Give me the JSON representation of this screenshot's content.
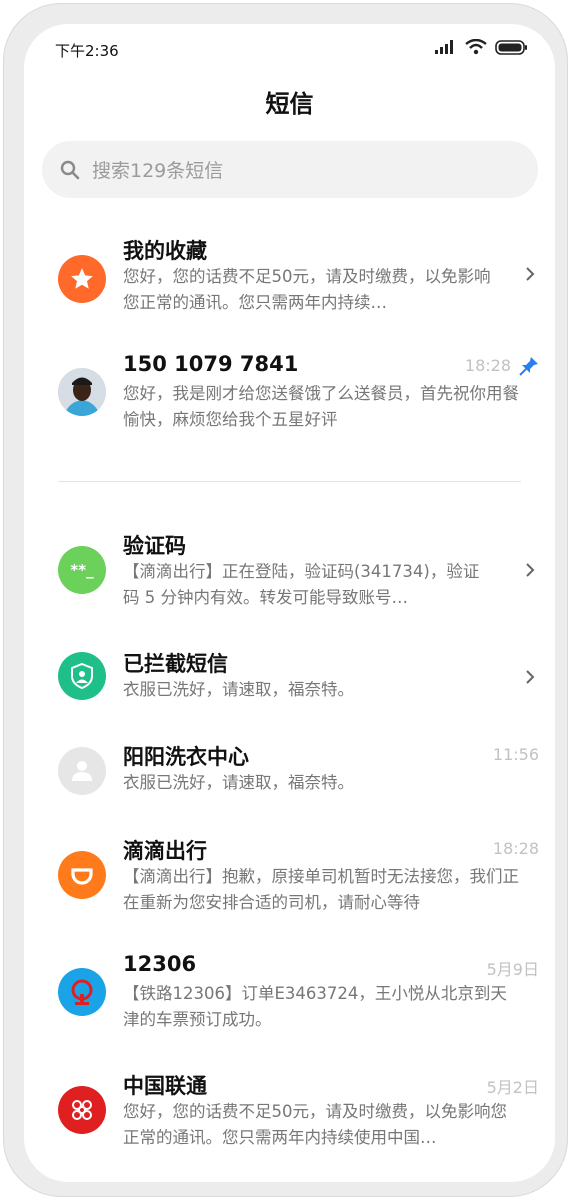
{
  "status_bar": {
    "time": "下午2:36"
  },
  "page": {
    "title": "短信"
  },
  "search": {
    "placeholder": "搜索129条短信"
  },
  "colors": {
    "orange": "#ff6a2a",
    "green": "#6bd15a",
    "teal": "#1fbf8a",
    "gray": "#e6e6e6",
    "red": "#e02020",
    "blue": "#1aa3e6",
    "pin": "#2a7ff0"
  },
  "pinned": [
    {
      "name": "我的收藏",
      "preview": "您好，您的话费不足50元，请及时缴费，以免影响您正常的通讯。您只需两年内持续…",
      "icon": "star-icon"
    },
    {
      "name": "150 1079 7841",
      "time": "18:28",
      "preview": "您好，我是刚才给您送餐饿了么送餐员，首先祝你用餐愉快，麻烦您给我个五星好评",
      "icon": "person-photo"
    }
  ],
  "conversations": [
    {
      "name": "验证码",
      "preview": "【滴滴出行】正在登陆，验证码(341734)，验证码 5 分钟内有效。转发可能导致账号…",
      "icon": "code-icon"
    },
    {
      "name": "已拦截短信",
      "preview": "衣服已洗好，请速取，福奈特。",
      "icon": "shield-icon"
    },
    {
      "name": "阳阳洗衣中心",
      "time": "11:56",
      "preview": "衣服已洗好，请速取，福奈特。",
      "icon": "person-icon"
    },
    {
      "name": "滴滴出行",
      "time": "18:28",
      "preview": "【滴滴出行】抱歉，原接单司机暂时无法接您，我们正在重新为您安排合适的司机，请耐心等待",
      "icon": "didi-icon"
    },
    {
      "name": "12306",
      "time": "5月9日",
      "preview": "【铁路12306】订单E3463724，王小悦从北京到天津的车票预订成功。",
      "icon": "railway-icon"
    },
    {
      "name": "中国联通",
      "time": "5月2日",
      "preview": "您好，您的话费不足50元，请及时缴费，以免影响您正常的通讯。您只需两年内持续使用中国…",
      "icon": "unicom-icon"
    }
  ]
}
